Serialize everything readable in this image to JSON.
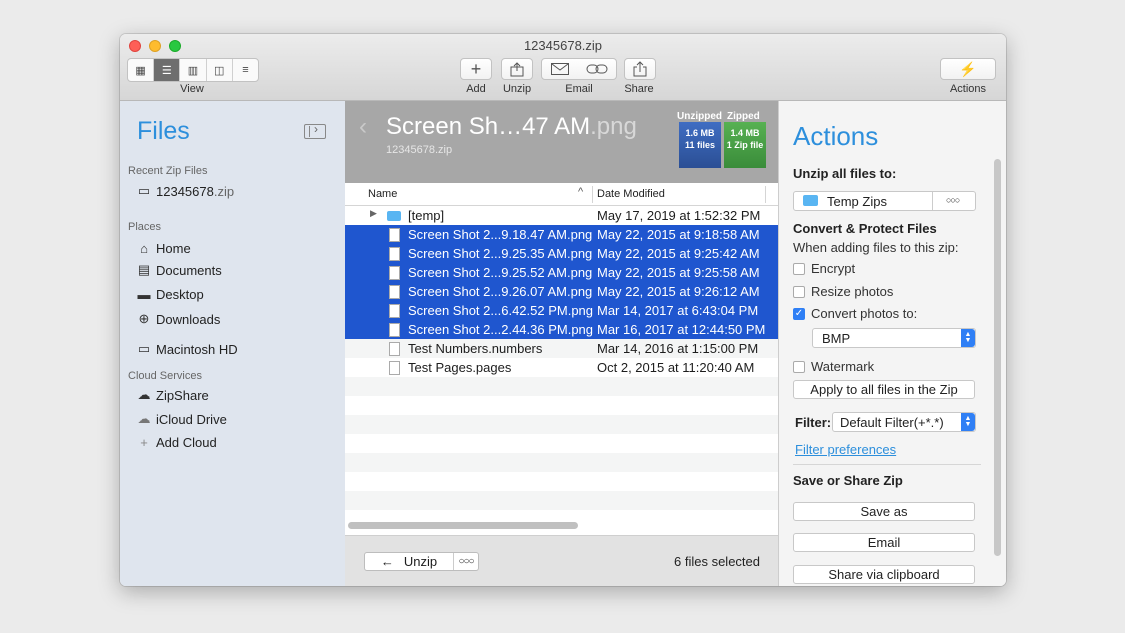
{
  "window": {
    "title": "12345678.zip"
  },
  "toolbar": {
    "view_label": "View",
    "buttons": [
      {
        "label": "Add",
        "icon": "plus-icon"
      },
      {
        "label": "Unzip",
        "icon": "unzip-icon"
      },
      {
        "label": "Email",
        "icon": "envelope-icon"
      },
      {
        "label": "Share",
        "icon": "share-icon"
      }
    ],
    "actions_label": "Actions"
  },
  "sidebar": {
    "title": "Files",
    "recent_label": "Recent Zip Files",
    "recent": [
      {
        "name": "12345678",
        "ext": ".zip"
      }
    ],
    "places_label": "Places",
    "places": [
      {
        "label": "Home",
        "icon": "home-icon"
      },
      {
        "label": "Documents",
        "icon": "documents-icon"
      },
      {
        "label": "Desktop",
        "icon": "desktop-icon"
      },
      {
        "label": "Downloads",
        "icon": "downloads-icon"
      },
      {
        "label": "Macintosh HD",
        "icon": "drive-icon"
      }
    ],
    "cloud_label": "Cloud Services",
    "cloud": [
      {
        "label": "ZipShare",
        "icon": "cloud-filled-icon"
      },
      {
        "label": "iCloud Drive",
        "icon": "cloud-icon"
      },
      {
        "label": "Add Cloud",
        "icon": "plus-icon"
      }
    ]
  },
  "archive": {
    "name_main": "Screen Sh…47 AM",
    "name_ext": ".png",
    "zip_name": "12345678.zip",
    "unzipped_label": "Unzipped",
    "zipped_label": "Zipped",
    "unzipped_size": "1.6 MB",
    "unzipped_count": "11 files",
    "zipped_size": "1.4 MB",
    "zipped_count": "1 Zip file",
    "col_name": "Name",
    "col_date": "Date Modified",
    "files": [
      {
        "name": "[temp]",
        "date": "May 17, 2019 at 1:52:32 PM",
        "selected": false,
        "folder": true
      },
      {
        "name": "Screen Shot 2...9.18.47 AM.png",
        "date": "May 22, 2015 at 9:18:58 AM",
        "selected": true
      },
      {
        "name": "Screen Shot 2...9.25.35 AM.png",
        "date": "May 22, 2015 at 9:25:42 AM",
        "selected": true
      },
      {
        "name": "Screen Shot 2...9.25.52 AM.png",
        "date": "May 22, 2015 at 9:25:58 AM",
        "selected": true
      },
      {
        "name": "Screen Shot 2...9.26.07 AM.png",
        "date": "May 22, 2015 at 9:26:12 AM",
        "selected": true
      },
      {
        "name": "Screen Shot 2...6.42.52 PM.png",
        "date": "Mar 14, 2017 at 6:43:04 PM",
        "selected": true
      },
      {
        "name": "Screen Shot 2...2.44.36 PM.png",
        "date": "Mar 16, 2017 at 12:44:50 PM",
        "selected": true
      },
      {
        "name": "Test Numbers.numbers",
        "date": "Mar 14, 2016 at 1:15:00 PM",
        "selected": false
      },
      {
        "name": "Test Pages.pages",
        "date": "Oct 2, 2015 at 11:20:40 AM",
        "selected": false
      }
    ],
    "unzip_button": "Unzip",
    "selection_status": "6 files selected"
  },
  "actions": {
    "title": "Actions",
    "unzip_all_label": "Unzip all files to:",
    "destination": "Temp Zips",
    "convert_heading": "Convert & Protect Files",
    "when_adding": "When adding files to this zip:",
    "encrypt": {
      "label": "Encrypt",
      "checked": false
    },
    "resize": {
      "label": "Resize photos",
      "checked": false
    },
    "convert": {
      "label": "Convert photos to:",
      "checked": true
    },
    "format": "BMP",
    "watermark": {
      "label": "Watermark",
      "checked": false
    },
    "apply_button": "Apply to all files in the Zip",
    "filter_label": "Filter:",
    "filter_value": "Default Filter(+*.*)",
    "filter_link": "Filter preferences",
    "save_heading": "Save or Share Zip",
    "save_as": "Save as",
    "email": "Email",
    "share_clipboard": "Share via clipboard"
  },
  "colors": {
    "accent": "#2d8fdc",
    "selection": "#1f56cf",
    "sidebar": "#dfe5ee"
  }
}
